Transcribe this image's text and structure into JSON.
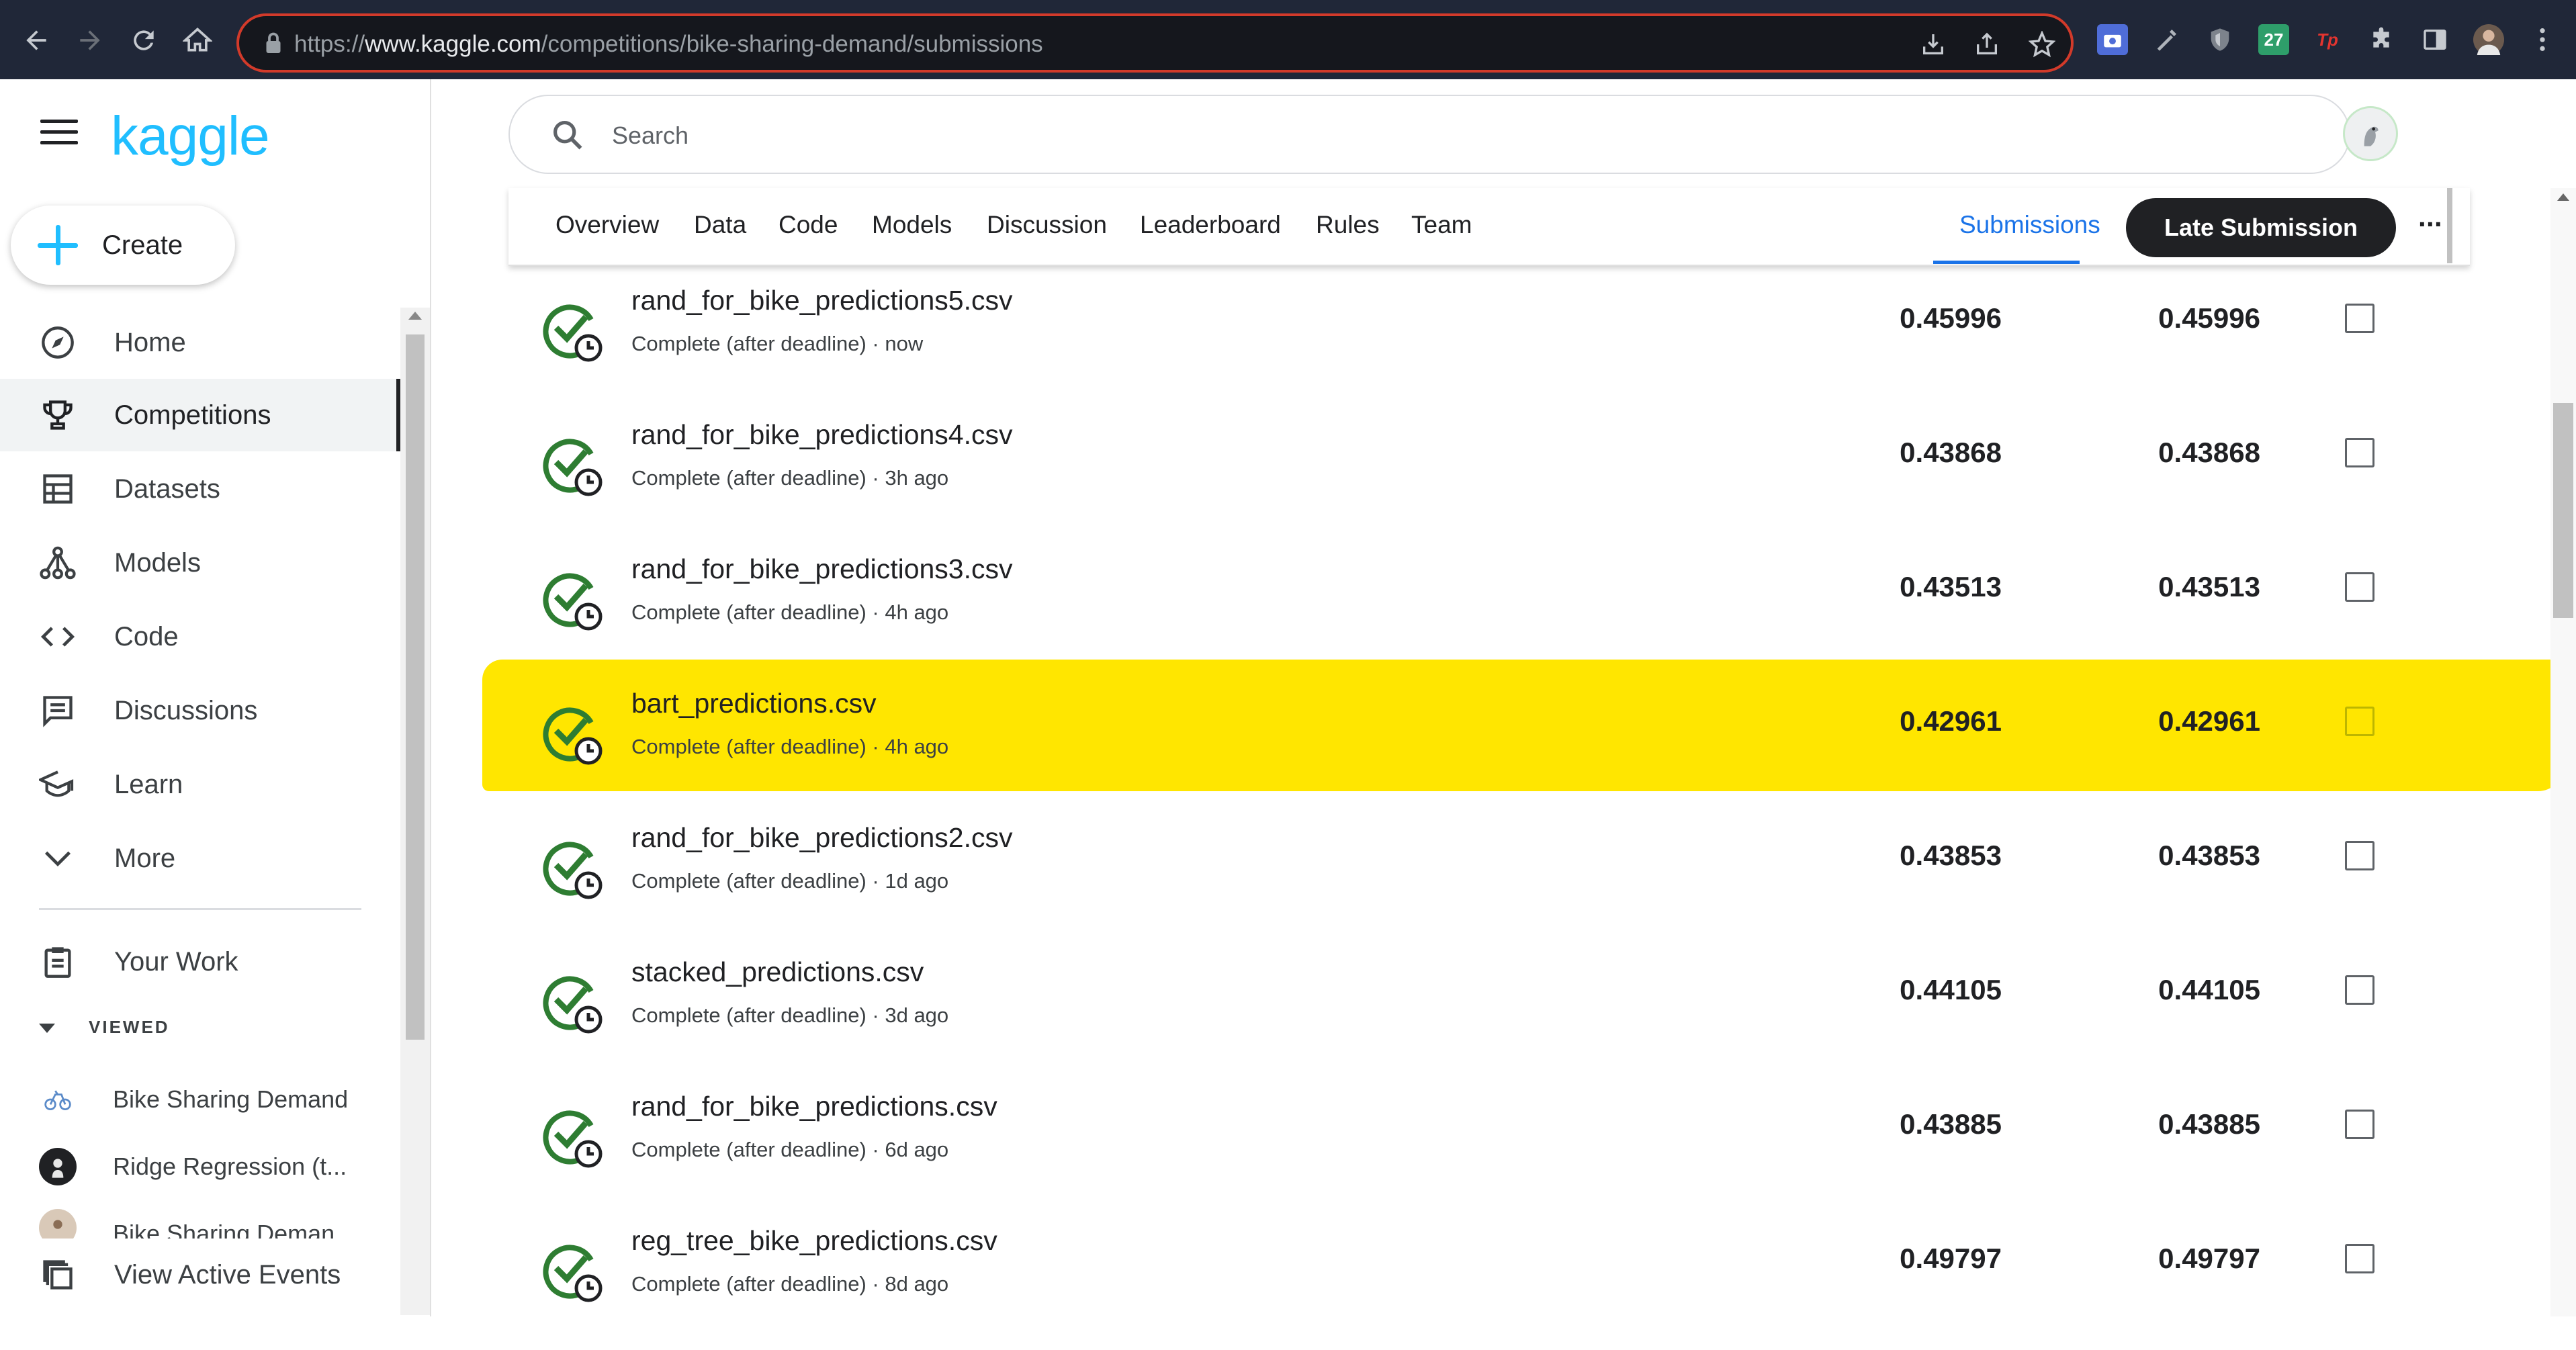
{
  "browser": {
    "url_prefix": "https://",
    "url_domain": "www.kaggle.com",
    "url_path": "/competitions/bike-sharing-demand/submissions",
    "extension_badge": "27",
    "extension_tp": "Tp"
  },
  "sidebar": {
    "logo": "kaggle",
    "create_label": "Create",
    "items": [
      {
        "label": "Home",
        "icon": "compass-icon"
      },
      {
        "label": "Competitions",
        "icon": "trophy-icon"
      },
      {
        "label": "Datasets",
        "icon": "table-icon"
      },
      {
        "label": "Models",
        "icon": "models-icon"
      },
      {
        "label": "Code",
        "icon": "code-icon"
      },
      {
        "label": "Discussions",
        "icon": "comments-icon"
      },
      {
        "label": "Learn",
        "icon": "school-icon"
      },
      {
        "label": "More",
        "icon": "chevron-down-icon"
      }
    ],
    "your_work": "Your Work",
    "viewed_header": "VIEWED",
    "viewed": [
      {
        "label": "Bike Sharing Demand"
      },
      {
        "label": "Ridge Regression (t..."
      },
      {
        "label": "Bike Sharing Deman..."
      }
    ],
    "view_active_events": "View Active Events"
  },
  "search": {
    "placeholder": "Search"
  },
  "tabs": {
    "items": [
      "Overview",
      "Data",
      "Code",
      "Models",
      "Discussion",
      "Leaderboard",
      "Rules",
      "Team"
    ],
    "submissions": "Submissions",
    "late_submission": "Late Submission",
    "more": "···"
  },
  "submissions": [
    {
      "file": "rand_for_bike_predictions5.csv",
      "status": "Complete (after deadline) · now",
      "private": "0.45996",
      "public": "0.45996",
      "highlighted": false
    },
    {
      "file": "rand_for_bike_predictions4.csv",
      "status": "Complete (after deadline) · 3h ago",
      "private": "0.43868",
      "public": "0.43868",
      "highlighted": false
    },
    {
      "file": "rand_for_bike_predictions3.csv",
      "status": "Complete (after deadline) · 4h ago",
      "private": "0.43513",
      "public": "0.43513",
      "highlighted": false
    },
    {
      "file": "bart_predictions.csv",
      "status": "Complete (after deadline) · 4h ago",
      "private": "0.42961",
      "public": "0.42961",
      "highlighted": true
    },
    {
      "file": "rand_for_bike_predictions2.csv",
      "status": "Complete (after deadline) · 1d ago",
      "private": "0.43853",
      "public": "0.43853",
      "highlighted": false
    },
    {
      "file": "stacked_predictions.csv",
      "status": "Complete (after deadline) · 3d ago",
      "private": "0.44105",
      "public": "0.44105",
      "highlighted": false
    },
    {
      "file": "rand_for_bike_predictions.csv",
      "status": "Complete (after deadline) · 6d ago",
      "private": "0.43885",
      "public": "0.43885",
      "highlighted": false
    },
    {
      "file": "reg_tree_bike_predictions.csv",
      "status": "Complete (after deadline) · 8d ago",
      "private": "0.49797",
      "public": "0.49797",
      "highlighted": false
    }
  ],
  "colors": {
    "accent": "#20beff",
    "highlight": "#ffe600",
    "success": "#2e7d32",
    "tab_active": "#1a73e8"
  }
}
